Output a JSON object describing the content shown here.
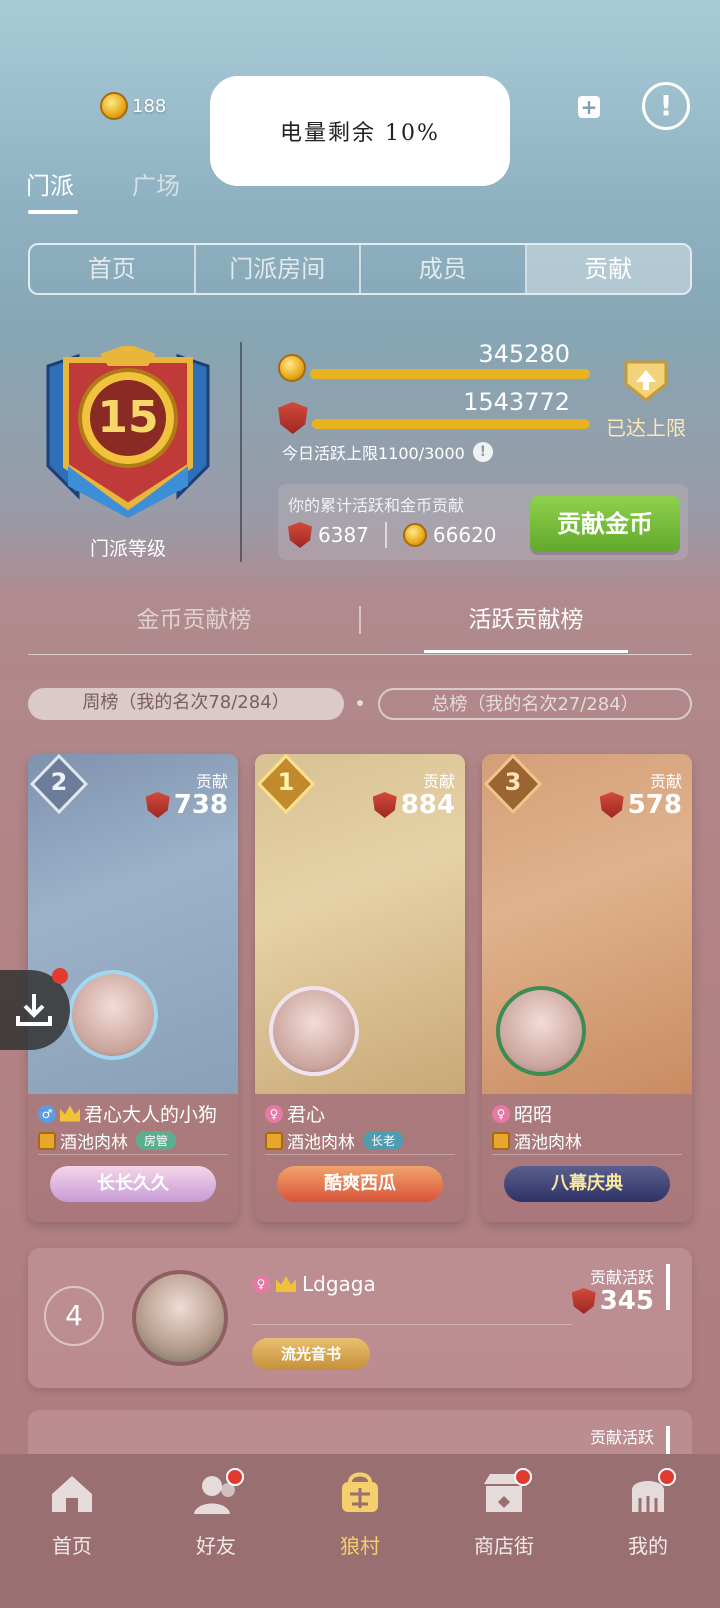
{
  "header": {
    "coins": "188",
    "battery_toast": "电量剩余 10%"
  },
  "main_tabs": [
    {
      "label": "门派",
      "active": true
    },
    {
      "label": "广场",
      "active": false
    },
    {
      "label": "",
      "active": false
    }
  ],
  "sub_tabs": [
    {
      "label": "首页",
      "active": false
    },
    {
      "label": "门派房间",
      "active": false
    },
    {
      "label": "成员",
      "active": false
    },
    {
      "label": "贡献",
      "active": true
    }
  ],
  "guild": {
    "level": "15",
    "level_label": "门派等级",
    "coin_value": "345280",
    "active_value": "1543772",
    "coin_progress": 1.0,
    "active_progress": 1.0,
    "today_limit": "今日活跃上限1100/3000",
    "cap_text": "已达上限"
  },
  "contribution": {
    "title": "你的累计活跃和金币贡献",
    "active": "6387",
    "coins": "66620",
    "donate_label": "贡献金币"
  },
  "rank_tabs": [
    {
      "label": "金币贡献榜",
      "active": false
    },
    {
      "label": "活跃贡献榜",
      "active": true
    }
  ],
  "rank_filters": {
    "week": "周榜（我的名次78/284）",
    "total": "总榜（我的名次27/284）"
  },
  "top3": [
    {
      "rank": "2",
      "contrib_label": "贡献",
      "contrib": "738",
      "name": "君心大人的小狗",
      "gender": "male",
      "vip": "9",
      "clan": "酒池肉林",
      "role": "房管",
      "banner": "长长久久"
    },
    {
      "rank": "1",
      "contrib_label": "贡献",
      "contrib": "884",
      "name": "君心",
      "gender": "female",
      "vip": "",
      "clan": "酒池肉林",
      "role": "长老",
      "banner": "酷爽西瓜"
    },
    {
      "rank": "3",
      "contrib_label": "贡献",
      "contrib": "578",
      "name": "昭昭",
      "gender": "female",
      "vip": "",
      "clan": "酒池肉林",
      "role": "",
      "banner": "八幕庆典"
    }
  ],
  "rank4": {
    "rank": "4",
    "name": "Ldgaga",
    "vip": "6",
    "tag": "流光音书",
    "contrib_label": "贡献活跃",
    "contrib": "345"
  },
  "rank5": {
    "contrib_label": "贡献活跃"
  },
  "bottom_nav": [
    {
      "label": "首页",
      "icon": "home-icon",
      "active": false,
      "dot": false
    },
    {
      "label": "好友",
      "icon": "friends-icon",
      "active": false,
      "dot": true
    },
    {
      "label": "狼村",
      "icon": "village-icon",
      "active": true,
      "dot": false
    },
    {
      "label": "商店街",
      "icon": "shop-icon",
      "active": false,
      "dot": true
    },
    {
      "label": "我的",
      "icon": "profile-icon",
      "active": false,
      "dot": true
    }
  ],
  "colors": {
    "accent_gold": "#e9b31f",
    "button_green": "#6fb637",
    "badge_red": "#e23a2e"
  }
}
